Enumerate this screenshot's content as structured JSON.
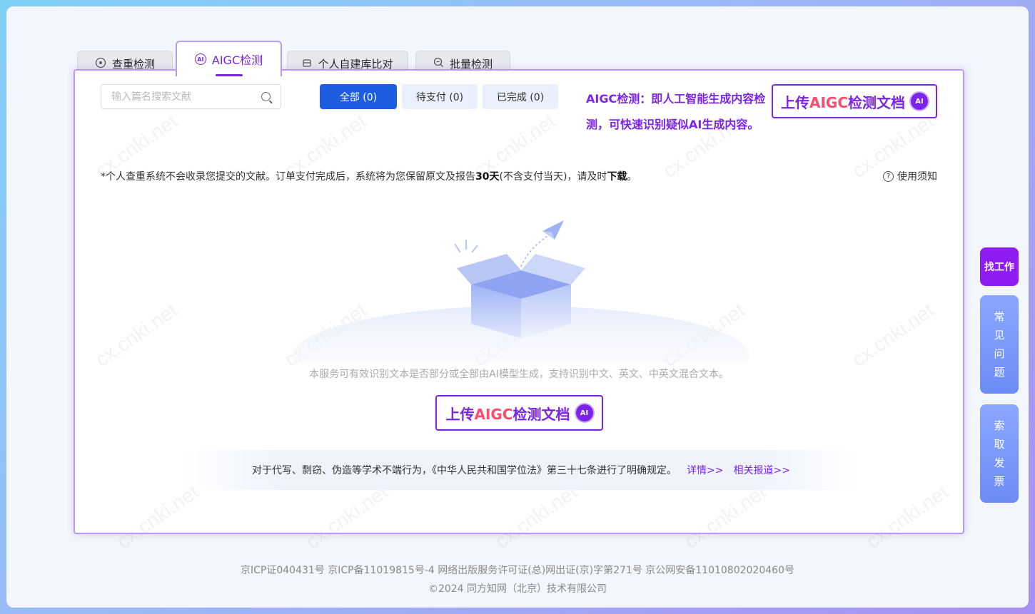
{
  "tabs": [
    {
      "label": "查重检测",
      "icon": "eye-scan-icon"
    },
    {
      "label": "AIGC检测",
      "icon": "ai-badge-icon",
      "active": true
    },
    {
      "label": "个人自建库比对",
      "icon": "database-icon"
    },
    {
      "label": "批量检测",
      "icon": "search-batch-icon"
    }
  ],
  "search": {
    "placeholder": "输入篇名搜索文献"
  },
  "filters": [
    {
      "label": "全部 (0)",
      "active": true
    },
    {
      "label": "待支付 (0)"
    },
    {
      "label": "已完成 (0)"
    }
  ],
  "aigc_desc": "AIGC检测：即人工智能生成内容检测，可快速识别疑似AI生成内容。",
  "upload": {
    "prefix": "上传",
    "highlight": "AIGC",
    "suffix": "检测文档",
    "badge": "AI"
  },
  "notice": {
    "part1": "*个人查重系统不会收录您提交的文献。订单支付完成后，系统将为您保留原文及报告",
    "bold1": "30天",
    "part2": "(不含支付当天)，请及时",
    "bold2": "下载",
    "part3": "。"
  },
  "help_label": "使用须知",
  "empty_desc": "本服务可有效识别文本是否部分或全部由AI模型生成，支持识别中文、英文、中英文混合文本。",
  "law": {
    "text": "对于代写、剽窃、伪造等学术不端行为，《中华人民共和国学位法》第三十七条进行了明确规定。",
    "link1": "详情>>",
    "link2": "相关报道>>"
  },
  "side": {
    "job": "找工作",
    "faq": [
      "常",
      "见",
      "问",
      "题"
    ],
    "invoice": [
      "索",
      "取",
      "发",
      "票"
    ]
  },
  "watermark": "cx.cnki.net",
  "footer": {
    "line1": "京ICP证040431号 京ICP备11019815号-4 网络出版服务许可证(总)网出证(京)字第271号 京公网安备11010802020460号",
    "line2": "©2024 同方知网（北京）技术有限公司"
  },
  "colors": {
    "accent": "#7b24e8",
    "primary": "#1e5ce0",
    "highlight": "#ff4d6d"
  }
}
